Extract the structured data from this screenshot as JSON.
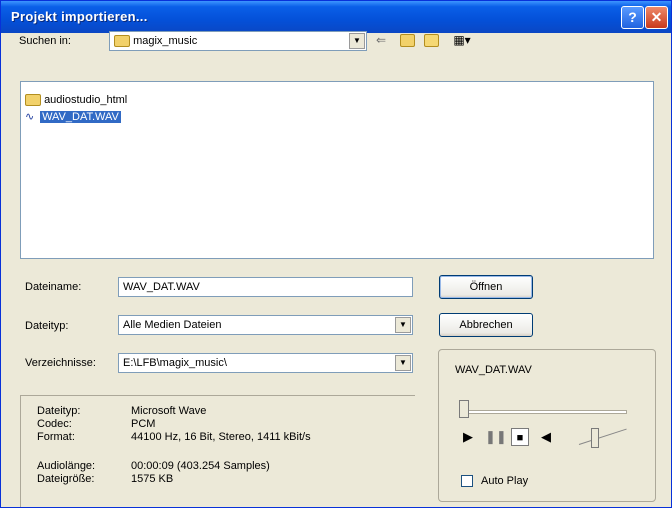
{
  "window": {
    "title": "Projekt importieren...",
    "help_label": "?",
    "close_label": "✕"
  },
  "lookin": {
    "label": "Suchen in:",
    "value": "magix_music",
    "dropdown_glyph": "▼"
  },
  "toolbar": {
    "back_icon": "back-arrow-icon",
    "up_icon": "up-folder-icon",
    "newfolder_icon": "new-folder-icon",
    "view_icon": "view-menu-icon"
  },
  "files": [
    {
      "name": "audiostudio_html",
      "icon": "folder-icon"
    },
    {
      "name": "WAV_DAT.WAV",
      "icon": "wave-file-icon",
      "selected": true
    }
  ],
  "fields": {
    "filename_label": "Dateiname:",
    "filename_value": "WAV_DAT.WAV",
    "filetype_label": "Dateityp:",
    "filetype_value": "Alle Medien Dateien",
    "dir_label": "Verzeichnisse:",
    "dir_value": "E:\\LFB\\magix_music\\"
  },
  "buttons": {
    "open": "Öffnen",
    "cancel": "Abbrechen"
  },
  "info": {
    "type_label": "Dateityp:",
    "type_value": "Microsoft Wave",
    "codec_label": "Codec:",
    "codec_value": "PCM",
    "format_label": "Format:",
    "format_value": "44100 Hz, 16 Bit, Stereo, 1411 kBit/s",
    "length_label": "Audiolänge:",
    "length_value": "00:00:09  (403.254 Samples)",
    "size_label": "Dateigröße:",
    "size_value": "1575 KB"
  },
  "preview": {
    "filename": "WAV_DAT.WAV",
    "position": 0,
    "autoplay_label": "Auto Play",
    "autoplay_checked": false
  },
  "colors": {
    "titlebar": "#0450d8",
    "selection": "#316ac5",
    "dialog_bg": "#ece9d8"
  }
}
